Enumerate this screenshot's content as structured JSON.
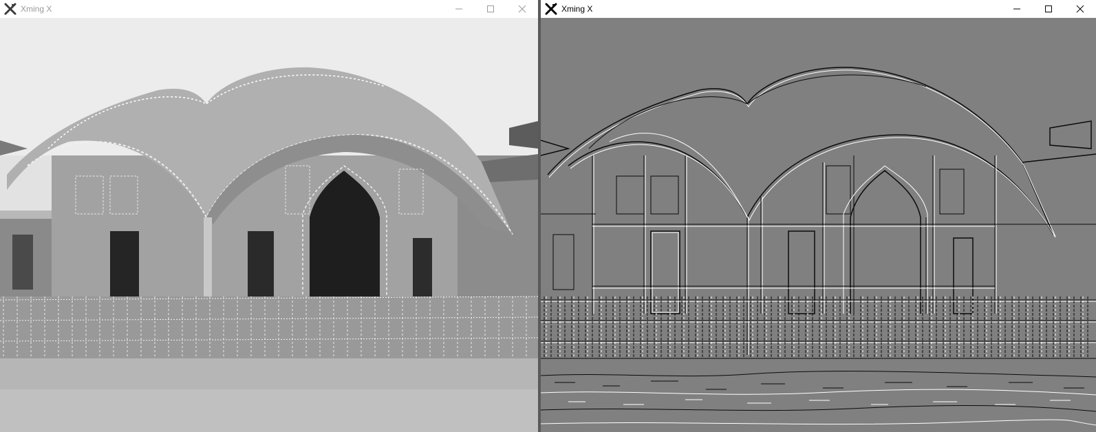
{
  "windows": [
    {
      "title": "Xming X",
      "content": "grayscale-photo",
      "active": false,
      "caption_buttons": [
        "minimize",
        "maximize",
        "close"
      ]
    },
    {
      "title": "Xming X",
      "content": "edge-detection-image",
      "active": true,
      "caption_buttons": [
        "minimize",
        "maximize",
        "close"
      ]
    }
  ],
  "colors": {
    "left_sky": "#e4e4e4",
    "left_building": "#9a9a9a",
    "left_ground": "#b4b4b4",
    "right_background": "#808080",
    "edge_dark": "#0a0a0a",
    "edge_light": "#ffffff"
  },
  "icons": {
    "app": "xming-x-icon",
    "minimize": "minimize-icon",
    "maximize": "maximize-icon",
    "close": "close-icon"
  }
}
